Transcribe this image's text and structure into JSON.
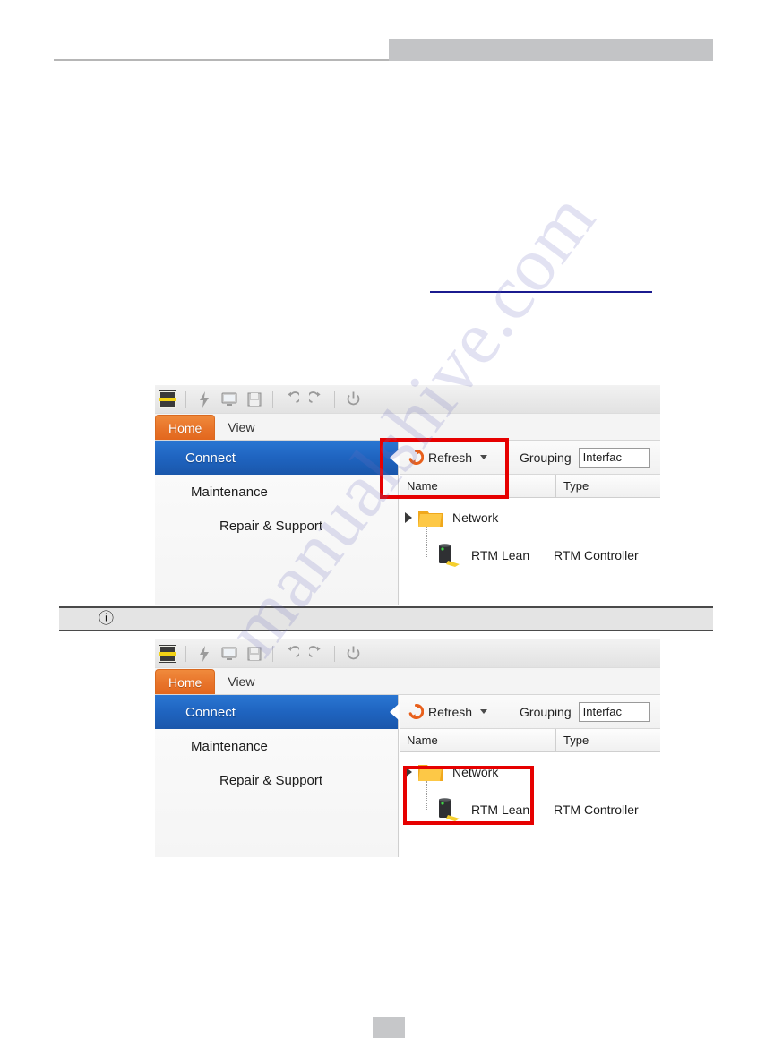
{
  "document": {
    "header": {
      "rule_present": true,
      "block_present": true
    },
    "redacted_link": {
      "present": true
    },
    "watermark": {
      "text": "manualshive.com"
    },
    "page_number_placeholder": {
      "label": ""
    }
  },
  "note": {
    "icon": "info-icon",
    "glyph": "ⓘ",
    "text": ""
  },
  "app": {
    "logo_name": "app-logo-icon",
    "quick_access": [
      {
        "name": "lightning-icon",
        "glyph": "⚡"
      },
      {
        "name": "monitor-icon",
        "glyph": "☐"
      },
      {
        "name": "save-icon",
        "glyph": "ὋE"
      },
      {
        "name": "undo-icon",
        "glyph": "↺"
      },
      {
        "name": "redo-icon",
        "glyph": "↻"
      },
      {
        "name": "power-icon",
        "glyph": "⏻"
      }
    ],
    "tabs": [
      {
        "label": "Home",
        "active": true
      },
      {
        "label": "View",
        "active": false
      }
    ],
    "nav": {
      "selected": "Connect",
      "items": [
        {
          "label": "Maintenance",
          "level": 1
        },
        {
          "label": "Repair & Support",
          "level": 2
        }
      ]
    },
    "command_bar": {
      "refresh_label": "Refresh",
      "grouping_label": "Grouping",
      "grouping_value": "Interfac"
    },
    "table": {
      "columns": [
        {
          "label": "Name"
        },
        {
          "label": "Type"
        }
      ],
      "rows": [
        {
          "name": "Network",
          "type": "",
          "kind": "folder",
          "expanded": true
        },
        {
          "name": "RTM Lean",
          "type": "RTM Controller",
          "kind": "device"
        }
      ]
    },
    "colors": {
      "tab_active": "#e8742a",
      "nav_selected": "#1f64c0",
      "highlight_box": "#e60000",
      "refresh_icon": "#e8601c",
      "folder": "#f5b425"
    }
  },
  "screenshots": [
    {
      "id": "shot-refresh",
      "highlight": "refresh-button"
    },
    {
      "id": "shot-network",
      "highlight": "network-tree-node"
    }
  ]
}
